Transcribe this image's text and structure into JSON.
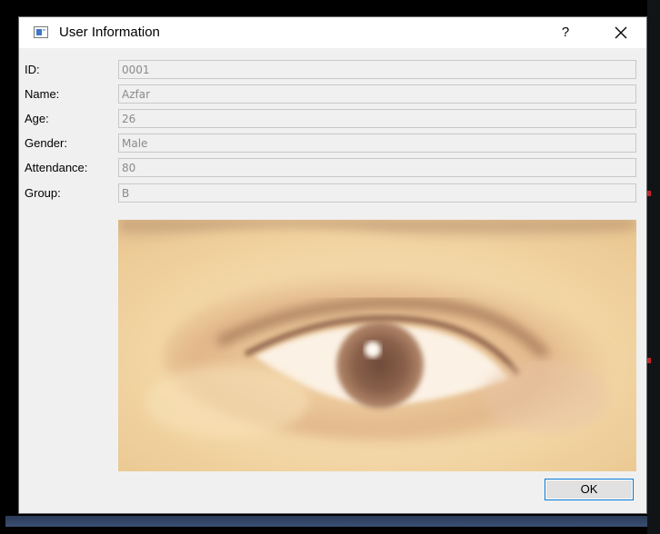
{
  "dialog": {
    "title": "User Information",
    "help_label": "?",
    "close_icon": "close-icon",
    "title_icon": "window-icon"
  },
  "fields": [
    {
      "label": "ID:",
      "value": "0001"
    },
    {
      "label": "Name:",
      "value": "Azfar"
    },
    {
      "label": "Age:",
      "value": "26"
    },
    {
      "label": "Gender:",
      "value": "Male"
    },
    {
      "label": "Attendance:",
      "value": "80"
    },
    {
      "label": "Group:",
      "value": "B"
    }
  ],
  "actions": {
    "ok_label": "OK"
  },
  "colors": {
    "dialog_background": "#f0f0f0",
    "titlebar_background": "#ffffff",
    "ok_border": "#0078d7",
    "desktop_background": "#000000"
  }
}
